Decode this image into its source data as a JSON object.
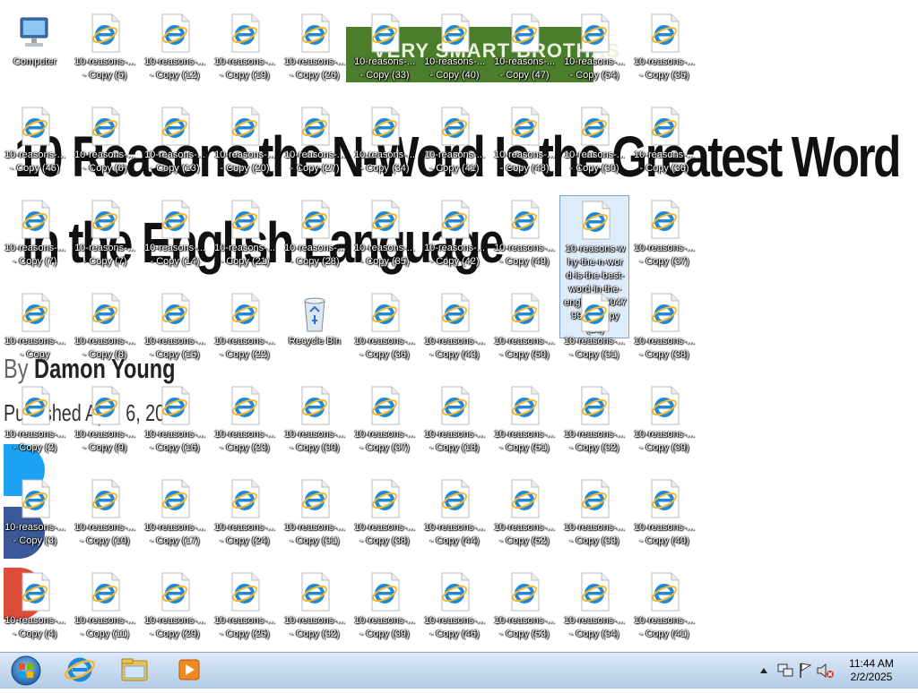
{
  "wallpaper": {
    "banner_text": "VERY SMART BROTHAS",
    "headline_line1": "10 Reasons the N-Word Is the Greatest Word",
    "headline_line2": "in the English Language",
    "byline_prefix": "By",
    "byline_author": "Damon Young",
    "published": "Published  April 6, 2016"
  },
  "desktop": {
    "columns": [
      [
        {
          "type": "computer",
          "lines": [
            "Computer"
          ]
        },
        {
          "type": "ie",
          "lines": [
            "10-reasons-...",
            "- Copy (45)"
          ]
        },
        {
          "type": "ie",
          "lines": [
            "10-reasons-...",
            "- Copy (7)"
          ]
        },
        {
          "type": "ie",
          "lines": [
            "10-reasons-...",
            "- Copy"
          ]
        },
        {
          "type": "ie",
          "lines": [
            "10-reasons-...",
            "- Copy (2)"
          ]
        },
        {
          "type": "ie",
          "lines": [
            "10-reasons-...",
            "- Copy (3)"
          ]
        },
        {
          "type": "ie",
          "lines": [
            "10-reasons-...",
            "- Copy (4)"
          ]
        }
      ],
      [
        {
          "type": "ie",
          "lines": [
            "10-reasons-...",
            "- Copy (5)"
          ]
        },
        {
          "type": "ie",
          "lines": [
            "10-reasons-...",
            "- Copy (6)"
          ]
        },
        {
          "type": "ie",
          "lines": [
            "10-reasons-...",
            "- Copy (7)"
          ]
        },
        {
          "type": "ie",
          "lines": [
            "10-reasons-...",
            "- Copy (8)"
          ]
        },
        {
          "type": "ie",
          "lines": [
            "10-reasons-...",
            "- Copy (9)"
          ]
        },
        {
          "type": "ie",
          "lines": [
            "10-reasons-...",
            "- Copy (10)"
          ]
        },
        {
          "type": "ie",
          "lines": [
            "10-reasons-...",
            "- Copy (11)"
          ]
        }
      ],
      [
        {
          "type": "ie",
          "lines": [
            "10-reasons-...",
            "- Copy (12)"
          ]
        },
        {
          "type": "ie",
          "lines": [
            "10-reasons-...",
            "- Copy (13)"
          ]
        },
        {
          "type": "ie",
          "lines": [
            "10-reasons-...",
            "- Copy (14)"
          ]
        },
        {
          "type": "ie",
          "lines": [
            "10-reasons-...",
            "- Copy (15)"
          ]
        },
        {
          "type": "ie",
          "lines": [
            "10-reasons-...",
            "- Copy (16)"
          ]
        },
        {
          "type": "ie",
          "lines": [
            "10-reasons-...",
            "- Copy (17)"
          ]
        },
        {
          "type": "ie",
          "lines": [
            "10-reasons-...",
            "- Copy (29)"
          ]
        }
      ],
      [
        {
          "type": "ie",
          "lines": [
            "10-reasons-...",
            "- Copy (19)"
          ]
        },
        {
          "type": "ie",
          "lines": [
            "10-reasons-...",
            "- Copy (20)"
          ]
        },
        {
          "type": "ie",
          "lines": [
            "10-reasons-...",
            "- Copy (21)"
          ]
        },
        {
          "type": "ie",
          "lines": [
            "10-reasons-...",
            "- Copy (22)"
          ]
        },
        {
          "type": "ie",
          "lines": [
            "10-reasons-...",
            "- Copy (23)"
          ]
        },
        {
          "type": "ie",
          "lines": [
            "10-reasons-...",
            "- Copy (24)"
          ]
        },
        {
          "type": "ie",
          "lines": [
            "10-reasons-...",
            "- Copy (25)"
          ]
        }
      ],
      [
        {
          "type": "ie",
          "lines": [
            "10-reasons-...",
            "- Copy (26)"
          ]
        },
        {
          "type": "ie",
          "lines": [
            "10-reasons-...",
            "- Copy (27)"
          ]
        },
        {
          "type": "ie",
          "lines": [
            "10-reasons-...",
            "- Copy (28)"
          ]
        },
        {
          "type": "recycle",
          "lines": [
            "Recycle Bin"
          ]
        },
        {
          "type": "ie",
          "lines": [
            "10-reasons-...",
            "- Copy (30)"
          ]
        },
        {
          "type": "ie",
          "lines": [
            "10-reasons-...",
            "- Copy (31)"
          ]
        },
        {
          "type": "ie",
          "lines": [
            "10-reasons-...",
            "- Copy (32)"
          ]
        }
      ],
      [
        {
          "type": "ie",
          "lines": [
            "10-reasons-...",
            "- Copy (33)"
          ]
        },
        {
          "type": "ie",
          "lines": [
            "10-reasons-...",
            "- Copy (34)"
          ]
        },
        {
          "type": "ie",
          "lines": [
            "10-reasons-...",
            "- Copy (35)"
          ]
        },
        {
          "type": "ie",
          "lines": [
            "10-reasons-...",
            "- Copy (36)"
          ]
        },
        {
          "type": "ie",
          "lines": [
            "10-reasons-...",
            "- Copy (37)"
          ]
        },
        {
          "type": "ie",
          "lines": [
            "10-reasons-...",
            "- Copy (38)"
          ]
        },
        {
          "type": "ie",
          "lines": [
            "10-reasons-...",
            "- Copy (39)"
          ]
        }
      ],
      [
        {
          "type": "ie",
          "lines": [
            "10-reasons-...",
            "- Copy (40)"
          ]
        },
        {
          "type": "ie",
          "lines": [
            "10-reasons-...",
            "- Copy (41)"
          ]
        },
        {
          "type": "ie",
          "lines": [
            "10-reasons-...",
            "- Copy (42)"
          ]
        },
        {
          "type": "ie",
          "lines": [
            "10-reasons-...",
            "- Copy (43)"
          ]
        },
        {
          "type": "ie",
          "lines": [
            "10-reasons-...",
            "- Copy (18)"
          ]
        },
        {
          "type": "ie",
          "lines": [
            "10-reasons-...",
            "- Copy (44)"
          ]
        },
        {
          "type": "ie",
          "lines": [
            "10-reasons-...",
            "- Copy (46)"
          ]
        }
      ],
      [
        {
          "type": "ie",
          "lines": [
            "10-reasons-...",
            "- Copy (47)"
          ]
        },
        {
          "type": "ie",
          "lines": [
            "10-reasons-...",
            "- Copy (48)"
          ]
        },
        {
          "type": "ie",
          "lines": [
            "10-reasons-...",
            "- Copy (49)"
          ]
        },
        {
          "type": "ie",
          "lines": [
            "10-reasons-...",
            "- Copy (50)"
          ]
        },
        {
          "type": "ie",
          "lines": [
            "10-reasons-...",
            "- Copy (51)"
          ]
        },
        {
          "type": "ie",
          "lines": [
            "10-reasons-...",
            "- Copy (52)"
          ]
        },
        {
          "type": "ie",
          "lines": [
            "10-reasons-...",
            "- Copy (53)"
          ]
        }
      ],
      [
        {
          "type": "ie",
          "lines": [
            "10-reasons-...",
            "- Copy (54)"
          ]
        },
        {
          "type": "ie",
          "lines": [
            "10-reasons-...",
            "- Copy (30)"
          ]
        },
        {
          "type": "ie",
          "selected": true,
          "lines": [
            "10-reasons-w",
            "hy-the-n-wor",
            "d-is-the-best-",
            "word-in-the-",
            "engli-1825047",
            "999 - Copy",
            "(29)"
          ]
        },
        {
          "type": "ie",
          "lines": [
            "10-reasons-...",
            "- Copy (31)"
          ]
        },
        {
          "type": "ie",
          "lines": [
            "10-reasons-...",
            "- Copy (32)"
          ]
        },
        {
          "type": "ie",
          "lines": [
            "10-reasons-...",
            "- Copy (33)"
          ]
        },
        {
          "type": "ie",
          "lines": [
            "10-reasons-...",
            "- Copy (34)"
          ]
        }
      ],
      [
        {
          "type": "ie",
          "lines": [
            "10-reasons-...",
            "- Copy (35)"
          ]
        },
        {
          "type": "ie",
          "lines": [
            "10-reasons-...",
            "- Copy (36)"
          ]
        },
        {
          "type": "ie",
          "lines": [
            "10-reasons-...",
            "- Copy (37)"
          ]
        },
        {
          "type": "ie",
          "lines": [
            "10-reasons-...",
            "- Copy (38)"
          ]
        },
        {
          "type": "ie",
          "lines": [
            "10-reasons-...",
            "- Copy (39)"
          ]
        },
        {
          "type": "ie",
          "lines": [
            "10-reasons-...",
            "- Copy (40)"
          ]
        },
        {
          "type": "ie",
          "lines": [
            "10-reasons-...",
            "- Copy (41)"
          ]
        }
      ]
    ]
  },
  "taskbar": {
    "time": "11:44 AM",
    "date": "2/2/2025",
    "pinned": [
      "start-orb-icon",
      "internet-explorer-icon",
      "windows-explorer-icon",
      "windows-media-player-icon"
    ],
    "tray": [
      "show-hidden-icons-chevron",
      "network-icon",
      "action-center-flag-icon",
      "volume-muted-icon"
    ]
  },
  "colors": {
    "taskbar_top": "#dce9f7",
    "taskbar_bottom": "#b4cbe7",
    "banner": "#4a7d2c",
    "ie_blue": "#1e88d8",
    "ie_ring": "#f2b632"
  }
}
